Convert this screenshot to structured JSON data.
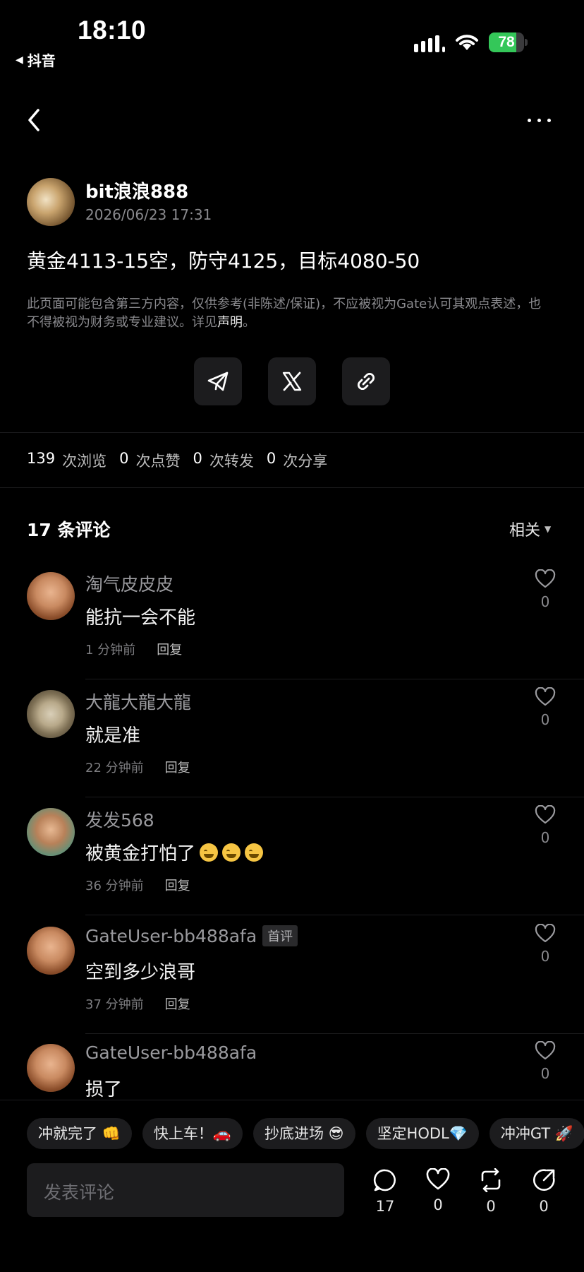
{
  "status_bar": {
    "time": "18:10",
    "back_app": "抖音",
    "battery": "78",
    "battery_level": 0.78
  },
  "post": {
    "author": "bit浪浪888",
    "date": "2026/06/23 17:31",
    "text": "黄金4113-15空，防守4125，目标4080-50",
    "disclaimer": "此页面可能包含第三方内容，仅供参考(非陈述/保证)，不应被视为Gate认可其观点表述，也不得被视为财务或专业建议。详见",
    "disclaimer_link": "声明",
    "disclaimer_end": "。"
  },
  "stats": [
    {
      "num": "139",
      "label": "次浏览"
    },
    {
      "num": "0",
      "label": "次点赞"
    },
    {
      "num": "0",
      "label": "次转发"
    },
    {
      "num": "0",
      "label": "次分享"
    }
  ],
  "comments_header": {
    "title": "17 条评论",
    "sort": "相关"
  },
  "comments": [
    {
      "user": "淘气皮皮皮",
      "badge": "",
      "text": "能抗一会不能",
      "time": "1 分钟前",
      "reply": "回复",
      "likes": "0"
    },
    {
      "user": "大龍大龍大龍",
      "badge": "",
      "text": "就是准",
      "time": "22 分钟前",
      "reply": "回复",
      "likes": "0"
    },
    {
      "user": "发发568",
      "badge": "",
      "text": "被黄金打怕了",
      "time": "36 分钟前",
      "reply": "回复",
      "likes": "0"
    },
    {
      "user": "GateUser-bb488afa",
      "badge": "首评",
      "text": "空到多少浪哥",
      "time": "37 分钟前",
      "reply": "回复",
      "likes": "0"
    },
    {
      "user": "GateUser-bb488afa",
      "badge": "",
      "text": "损了",
      "time": "",
      "reply": "",
      "likes": "0"
    }
  ],
  "chips": [
    "冲就完了 👊",
    "快上车！🚗",
    "抄底进场 😎",
    "坚定HODL💎",
    "冲冲GT 🚀"
  ],
  "composer": {
    "placeholder": "发表评论",
    "comments": "17",
    "likes": "0",
    "reposts": "0",
    "shares": "0"
  },
  "colors": {
    "background": "#000000",
    "accent_green": "#34c759",
    "card": "#1c1c1e"
  }
}
